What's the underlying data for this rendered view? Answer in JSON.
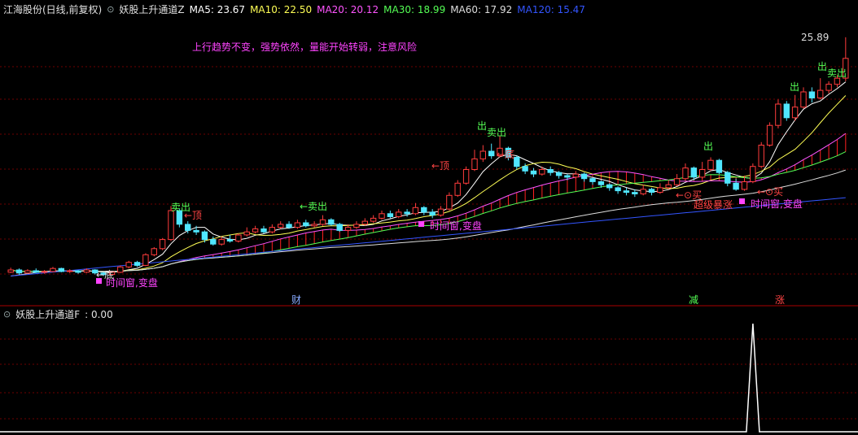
{
  "header": {
    "stock_name": "江海股份(日线,前复权)",
    "indicator_name": "妖股上升通道Z",
    "ma_items": [
      {
        "label": "MA5: 23.67",
        "color": "#ffffff"
      },
      {
        "label": "MA10: 22.50",
        "color": "#ffff55"
      },
      {
        "label": "MA20: 20.12",
        "color": "#ff55ff"
      },
      {
        "label": "MA30: 18.99",
        "color": "#55ff55"
      },
      {
        "label": "MA60: 17.92",
        "color": "#dddddd"
      },
      {
        "label": "MA120: 15.47",
        "color": "#3355ff"
      }
    ]
  },
  "notice": "上行趋势不变，强势依然，量能开始转弱，注意风险",
  "price_tag": "25.89",
  "annotations": {
    "sell_1": "卖出",
    "top_1": "←顶",
    "sell_2": "←卖出",
    "bottom_1": "←底",
    "time_window_1": "时间窗,变盘",
    "top_2": "←顶",
    "sell_3": "卖出",
    "out_1": "出",
    "time_window_2": "时间窗,变盘",
    "bottom_2": "←底",
    "out_2": "出",
    "buy_1": "←⊙买",
    "strong_rise": "超级暴涨",
    "time_window_3": "时间窗,变盘",
    "buy_2": "←⊙买",
    "out_3": "出",
    "sell_4": "卖出",
    "out_4": "出"
  },
  "markers": {
    "cai": "财",
    "jian": "减",
    "zhang": "涨"
  },
  "indicator_panel": {
    "title": "妖股上升通道F",
    "value": ": 0.00"
  },
  "colors": {
    "up": "#ff3c3c",
    "down": "#50e6ff",
    "bg": "#000000",
    "grid": "#6e0000"
  },
  "chart_data": [
    {
      "type": "candlestick",
      "title": "江海股份(日线,前复权)",
      "y_max_label": 25.89,
      "series": [
        {
          "name": "MA5",
          "last": 23.67
        },
        {
          "name": "MA10",
          "last": 22.5
        },
        {
          "name": "MA20",
          "last": 20.12
        },
        {
          "name": "MA30",
          "last": 18.99
        },
        {
          "name": "MA60",
          "last": 17.92
        },
        {
          "name": "MA120",
          "last": 15.47
        }
      ],
      "candles": [
        [
          10.45,
          10.6,
          10.75,
          10.4
        ],
        [
          10.6,
          10.4,
          10.7,
          10.3
        ],
        [
          10.4,
          10.55,
          10.65,
          10.35
        ],
        [
          10.55,
          10.45,
          10.7,
          10.4
        ],
        [
          10.45,
          10.5,
          10.6,
          10.35
        ],
        [
          10.5,
          10.7,
          10.8,
          10.45
        ],
        [
          10.7,
          10.5,
          10.75,
          10.45
        ],
        [
          10.5,
          10.55,
          10.65,
          10.4
        ],
        [
          10.55,
          10.45,
          10.6,
          10.35
        ],
        [
          10.45,
          10.6,
          10.7,
          10.4
        ],
        [
          10.6,
          10.4,
          10.65,
          10.3
        ],
        [
          10.4,
          10.3,
          10.45,
          10.2
        ],
        [
          10.3,
          10.45,
          10.55,
          10.25
        ],
        [
          10.45,
          10.8,
          10.9,
          10.4
        ],
        [
          10.8,
          11.1,
          11.2,
          10.7
        ],
        [
          11.1,
          10.9,
          11.2,
          10.8
        ],
        [
          10.9,
          11.6,
          11.7,
          10.85
        ],
        [
          11.6,
          12.0,
          12.1,
          11.5
        ],
        [
          12.0,
          12.6,
          12.7,
          11.9
        ],
        [
          12.6,
          14.5,
          14.8,
          12.5
        ],
        [
          14.5,
          13.6,
          14.6,
          13.4
        ],
        [
          13.6,
          13.2,
          13.8,
          13.0
        ],
        [
          13.2,
          13.1,
          13.5,
          12.9
        ],
        [
          13.1,
          12.6,
          13.2,
          12.4
        ],
        [
          12.6,
          12.3,
          12.8,
          12.2
        ],
        [
          12.3,
          12.6,
          12.8,
          12.2
        ],
        [
          12.6,
          12.5,
          12.9,
          12.4
        ],
        [
          12.5,
          12.9,
          13.0,
          12.4
        ],
        [
          12.9,
          13.1,
          13.4,
          12.8
        ],
        [
          13.1,
          13.3,
          13.5,
          13.0
        ],
        [
          13.3,
          13.1,
          13.5,
          13.0
        ],
        [
          13.1,
          13.4,
          13.6,
          13.0
        ],
        [
          13.4,
          13.6,
          13.8,
          13.3
        ],
        [
          13.6,
          13.4,
          13.8,
          13.3
        ],
        [
          13.4,
          13.7,
          13.9,
          13.3
        ],
        [
          13.7,
          13.5,
          13.9,
          13.4
        ],
        [
          13.5,
          13.6,
          13.8,
          13.4
        ],
        [
          13.6,
          13.9,
          14.2,
          13.5
        ],
        [
          13.9,
          13.6,
          14.0,
          13.5
        ],
        [
          13.6,
          13.2,
          13.7,
          13.1
        ],
        [
          13.2,
          13.4,
          13.6,
          13.1
        ],
        [
          13.4,
          13.6,
          13.8,
          13.3
        ],
        [
          13.6,
          13.8,
          14.0,
          13.5
        ],
        [
          13.8,
          14.0,
          14.2,
          13.7
        ],
        [
          14.0,
          14.3,
          14.5,
          13.9
        ],
        [
          14.3,
          14.1,
          14.5,
          14.0
        ],
        [
          14.1,
          14.4,
          14.6,
          14.0
        ],
        [
          14.4,
          14.3,
          14.6,
          14.1
        ],
        [
          14.3,
          14.7,
          15.0,
          14.2
        ],
        [
          14.7,
          14.4,
          14.8,
          14.2
        ],
        [
          14.4,
          14.2,
          14.6,
          14.0
        ],
        [
          14.2,
          14.6,
          14.8,
          14.1
        ],
        [
          14.6,
          15.5,
          15.7,
          14.5
        ],
        [
          15.5,
          16.3,
          16.5,
          15.4
        ],
        [
          16.3,
          17.2,
          17.4,
          16.2
        ],
        [
          17.2,
          17.9,
          18.5,
          17.1
        ],
        [
          17.9,
          18.4,
          18.8,
          17.7
        ],
        [
          18.4,
          18.1,
          18.9,
          17.9
        ],
        [
          18.1,
          18.6,
          19.4,
          18.0
        ],
        [
          18.6,
          18.0,
          18.7,
          17.8
        ],
        [
          18.0,
          17.4,
          18.1,
          17.2
        ],
        [
          17.4,
          17.1,
          17.6,
          16.9
        ],
        [
          17.1,
          16.9,
          17.3,
          16.7
        ],
        [
          16.9,
          17.2,
          17.4,
          16.8
        ],
        [
          17.2,
          17.0,
          17.4,
          16.8
        ],
        [
          17.0,
          16.8,
          17.1,
          16.6
        ],
        [
          16.8,
          16.7,
          16.9,
          16.5
        ],
        [
          16.7,
          16.9,
          17.1,
          16.6
        ],
        [
          16.9,
          16.6,
          17.0,
          16.4
        ],
        [
          16.6,
          16.4,
          16.7,
          16.2
        ],
        [
          16.4,
          16.2,
          16.5,
          16.0
        ],
        [
          16.2,
          16.0,
          16.3,
          15.8
        ],
        [
          16.0,
          15.8,
          16.1,
          15.6
        ],
        [
          15.8,
          15.7,
          16.0,
          15.5
        ],
        [
          15.7,
          15.6,
          15.9,
          15.4
        ],
        [
          15.6,
          15.9,
          16.2,
          15.5
        ],
        [
          15.9,
          15.7,
          16.0,
          15.5
        ],
        [
          15.7,
          16.0,
          16.3,
          15.6
        ],
        [
          16.0,
          16.2,
          16.5,
          15.9
        ],
        [
          16.2,
          16.6,
          16.9,
          16.1
        ],
        [
          16.6,
          17.3,
          17.6,
          16.5
        ],
        [
          17.3,
          16.7,
          17.4,
          16.5
        ],
        [
          16.7,
          17.2,
          17.7,
          16.6
        ],
        [
          17.2,
          17.8,
          18.0,
          17.1
        ],
        [
          17.8,
          17.0,
          17.9,
          16.9
        ],
        [
          17.0,
          16.3,
          17.1,
          16.1
        ],
        [
          16.3,
          15.9,
          16.6,
          15.8
        ],
        [
          15.9,
          16.4,
          16.8,
          15.8
        ],
        [
          16.4,
          17.4,
          17.6,
          16.3
        ],
        [
          17.4,
          18.8,
          19.0,
          17.3
        ],
        [
          18.8,
          20.1,
          20.3,
          18.7
        ],
        [
          20.1,
          21.5,
          21.8,
          19.9
        ],
        [
          21.5,
          20.6,
          21.7,
          20.4
        ],
        [
          20.6,
          21.3,
          22.1,
          20.4
        ],
        [
          21.3,
          22.3,
          22.6,
          21.2
        ],
        [
          22.3,
          21.9,
          22.6,
          21.6
        ],
        [
          21.9,
          22.4,
          23.2,
          21.8
        ],
        [
          22.4,
          22.8,
          23.0,
          22.2
        ],
        [
          22.8,
          23.2,
          23.4,
          22.6
        ],
        [
          23.2,
          24.5,
          25.89,
          23.0
        ]
      ]
    },
    {
      "type": "line",
      "title": "妖股上升通道F",
      "values_note": "single spike near bar 88, otherwise 0",
      "spike_index": 88
    }
  ]
}
